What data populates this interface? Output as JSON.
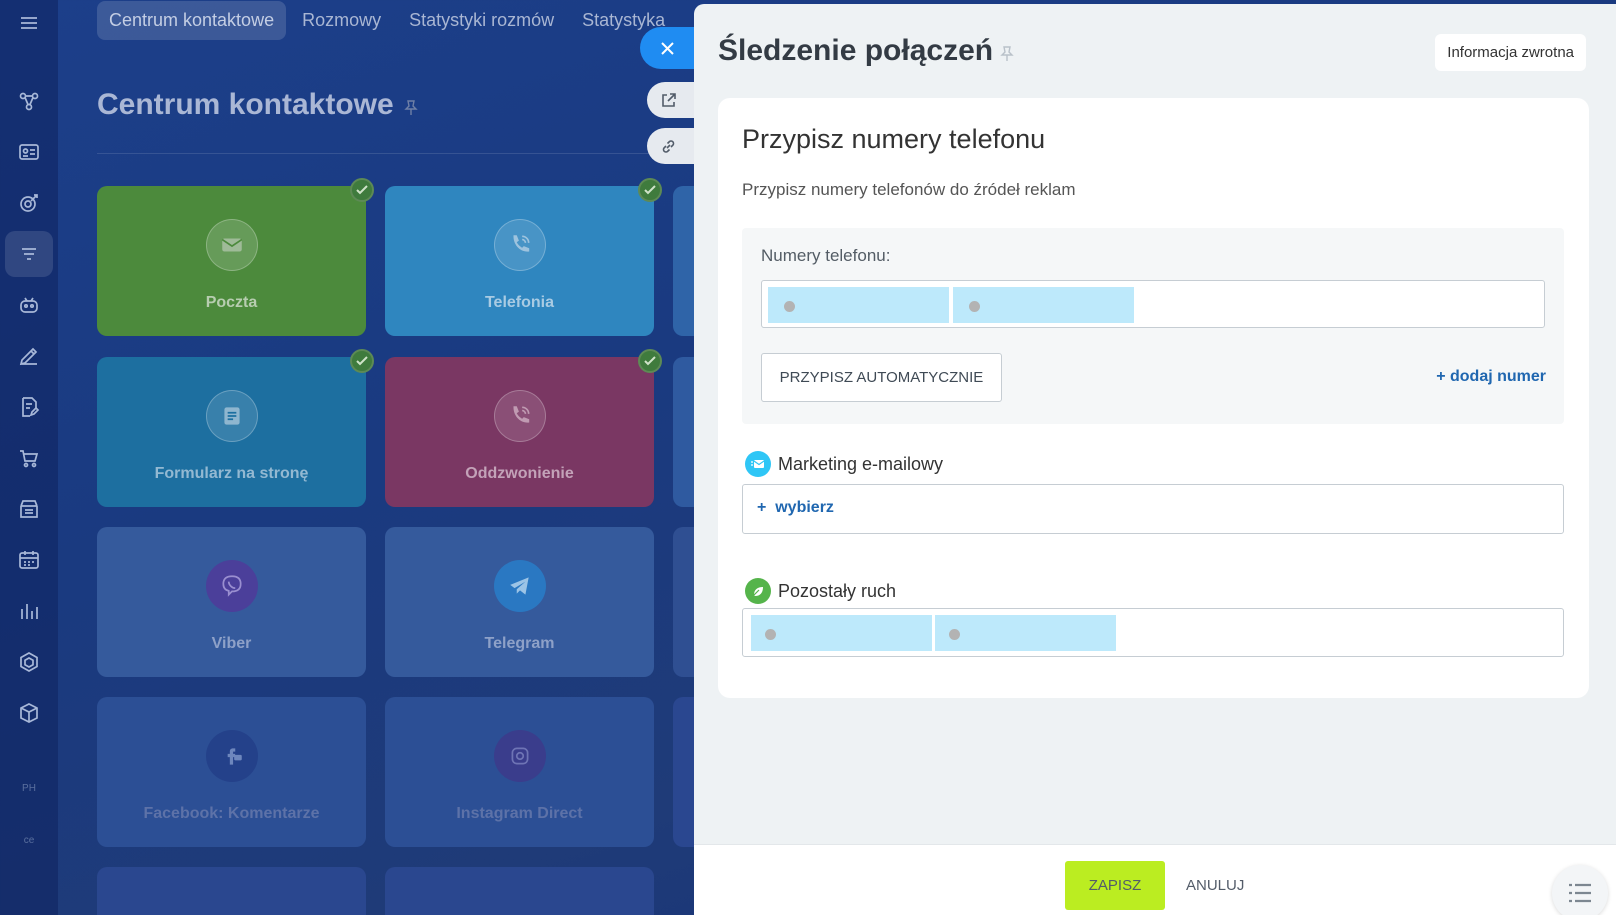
{
  "background": {
    "tabs": [
      {
        "label": "Centrum kontaktowe",
        "active": true
      },
      {
        "label": "Rozmowy",
        "active": false
      },
      {
        "label": "Statystyki rozmów",
        "active": false
      },
      {
        "label": "Statystyka",
        "active": false
      }
    ],
    "page_title": "Centrum kontaktowe",
    "tiles": [
      {
        "label": "Poczta",
        "icon": "mail-icon",
        "color": "#4c8a3c",
        "checked": true
      },
      {
        "label": "Telefonia",
        "icon": "phone-icon",
        "color": "#2f86bf",
        "checked": true
      },
      {
        "label": "Formularz na stronę",
        "icon": "form-icon",
        "color": "#1d6fa0",
        "checked": true
      },
      {
        "label": "Oddzwonienie",
        "icon": "phone-icon",
        "color": "#7a3763",
        "checked": true
      },
      {
        "label": "Viber",
        "icon": "viber-icon",
        "color": "#355a9c",
        "checked": false
      },
      {
        "label": "Telegram",
        "icon": "telegram-icon",
        "color": "#355a9c",
        "checked": false
      },
      {
        "label": "Facebook: Komentarze",
        "icon": "facebook-icon",
        "color": "#2c4f95",
        "checked": false
      },
      {
        "label": "Instagram Direct",
        "icon": "instagram-icon",
        "color": "#2c4f95",
        "checked": false
      }
    ],
    "rail_text": [
      "PH",
      "ce"
    ]
  },
  "slider": {
    "title": "Śledzenie połączeń",
    "feedback_label": "Informacja zwrotna",
    "card": {
      "heading": "Przypisz numery telefonu",
      "subheading": "Przypisz numery telefonów do źródeł reklam",
      "phones_label": "Numery telefonu:",
      "auto_assign_label": "PRZYPISZ AUTOMATYCZNIE",
      "add_number_label": "+ dodaj numer",
      "sections": [
        {
          "title": "Marketing e-mailowy",
          "icon": "email-marketing-icon",
          "color": "#2fc6f6",
          "choose_label": "wybierz"
        },
        {
          "title": "Pozostały ruch",
          "icon": "leaf-icon",
          "color": "#55b44b"
        }
      ]
    },
    "footer": {
      "save_label": "ZAPISZ",
      "cancel_label": "ANULUJ"
    }
  },
  "colors": {
    "accent": "#1f8cf2",
    "save": "#bbed21",
    "link": "#2067b0",
    "chip": "#bde9fb"
  }
}
